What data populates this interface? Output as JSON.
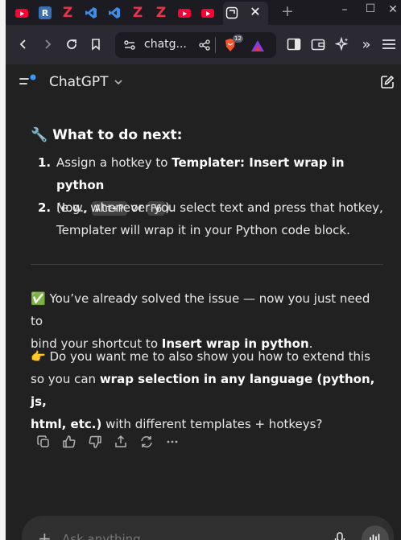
{
  "tabs": [
    {
      "name": "tab-youtube-1",
      "icon": "youtube-icon"
    },
    {
      "name": "tab-r",
      "icon": "r-icon",
      "letter": "R"
    },
    {
      "name": "tab-z-1",
      "icon": "z-icon",
      "letter": "Z"
    },
    {
      "name": "tab-vscode-1",
      "icon": "vscode-icon"
    },
    {
      "name": "tab-vscode-2",
      "icon": "vscode-icon"
    },
    {
      "name": "tab-z-2",
      "icon": "z-icon",
      "letter": "Z"
    },
    {
      "name": "tab-z-3",
      "icon": "z-icon",
      "letter": "Z"
    },
    {
      "name": "tab-youtube-2",
      "icon": "youtube-icon"
    },
    {
      "name": "tab-youtube-3",
      "icon": "youtube-icon"
    },
    {
      "name": "tab-chatgpt",
      "icon": "chatgpt-icon",
      "active": true
    }
  ],
  "url": {
    "text": "chatg..."
  },
  "brave": {
    "badge": "12"
  },
  "chat": {
    "title": "ChatGPT",
    "section": {
      "emoji": "🔧",
      "heading": "What to do next:"
    },
    "steps": [
      {
        "num": "1.",
        "pre": "Assign a hotkey to ",
        "bold": "Templater: Insert wrap in python",
        "line2_pre": "(e.g., ",
        "code1": "Alt+P",
        "mid": " or ",
        "code2": "F6",
        "post": ")."
      },
      {
        "num": "2.",
        "line1": "Now, whenever you select text and press that hotkey,",
        "line2": "Templater will wrap it in your Python code block."
      }
    ],
    "para1": {
      "emoji": "✅",
      "line1": " You’ve already solved the issue — now you just need to",
      "line2_pre": "bind your shortcut to ",
      "line2_bold": "Insert wrap in python",
      "line2_post": "."
    },
    "para2": {
      "emoji": "👉",
      "line1": " Do you want me to also show you how to extend this",
      "line2_pre": "so you can ",
      "line2_bold": "wrap selection in any language (python, js,",
      "line3_bold": "html, etc.)",
      "line3_post": " with different templates + hotkeys?"
    },
    "actions": [
      "copy-icon",
      "thumbs-up-icon",
      "thumbs-down-icon",
      "share-icon",
      "regenerate-icon",
      "more-icon"
    ]
  },
  "composer": {
    "placeholder": "Ask anything"
  },
  "colors": {
    "background": "#212121",
    "chrome": "#2b2a33",
    "tabstrip": "#1c1b22",
    "accent": "#339cff",
    "youtube": "#ff0033",
    "z": "#e8344a"
  }
}
